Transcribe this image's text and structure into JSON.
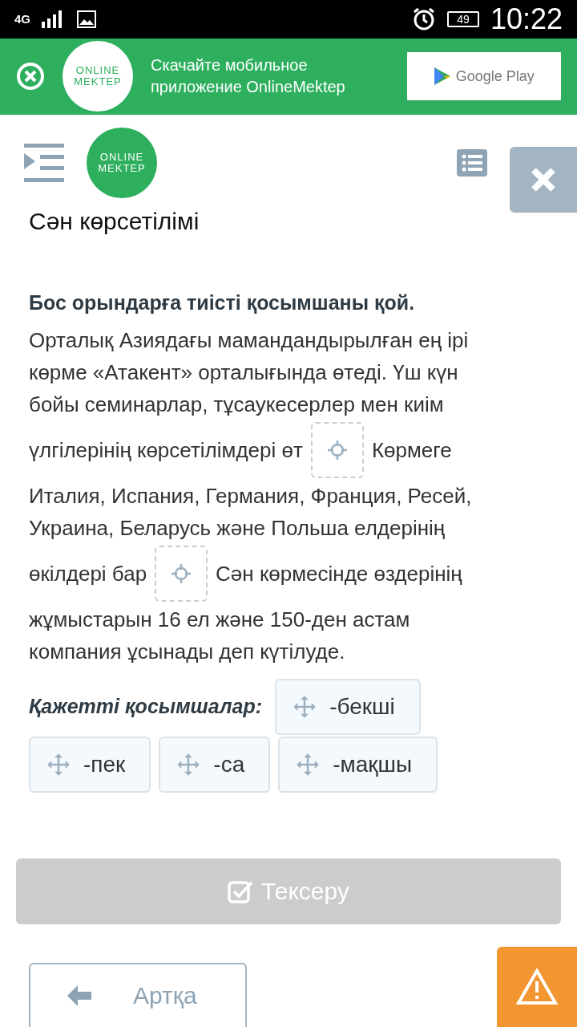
{
  "status_bar": {
    "network": "4G",
    "time": "10:22",
    "battery": "49"
  },
  "banner": {
    "logo": [
      "ONLINE",
      "MEKTEP"
    ],
    "text": "Скачайте мобильное приложение OnlineMektep",
    "store": "Google Play"
  },
  "header": {
    "logo": [
      "ONLINE",
      "MEKTEP"
    ]
  },
  "lesson_title": "Сән көрсетілімі",
  "task": {
    "instruction": "Бос орындарға тиісті қосымшаны қой.",
    "passage": [
      [
        {
          "kind": "text",
          "text": "Орталық Азиядағы мамандандырылған ең ірі"
        }
      ],
      [
        {
          "kind": "text",
          "text": "көрме «Атакент» орталығында өтеді. Үш күн"
        }
      ],
      [
        {
          "kind": "text",
          "text": "бойы семинарлар, тұсаукесерлер мен киім"
        }
      ],
      [
        {
          "kind": "text",
          "text": "үлгілерінің көрсетілімдері өт"
        },
        {
          "kind": "blank"
        },
        {
          "kind": "text",
          "text": "Көрмеге"
        }
      ],
      [
        {
          "kind": "text",
          "text": "Италия, Испания, Германия, Франция, Ресей,"
        }
      ],
      [
        {
          "kind": "text",
          "text": "Украина, Беларусь және Польша елдерінің"
        }
      ],
      [
        {
          "kind": "text",
          "text": "өкілдері бар"
        },
        {
          "kind": "blank"
        },
        {
          "kind": "text",
          "text": "Сән көрмесінде өздерінің"
        }
      ],
      [
        {
          "kind": "text",
          "text": "жұмыстарын 16 ел және 150-ден астам"
        }
      ],
      [
        {
          "kind": "text",
          "text": "компания ұсынады деп күтілуде."
        }
      ]
    ],
    "options_label": "Қажетті қосымшалар:",
    "options": [
      "-бекші",
      "-пек",
      "-са",
      "-мақшы"
    ]
  },
  "check_button": {
    "label": "Тексеру",
    "disabled": true
  },
  "back_button": {
    "label": "Артқа"
  }
}
